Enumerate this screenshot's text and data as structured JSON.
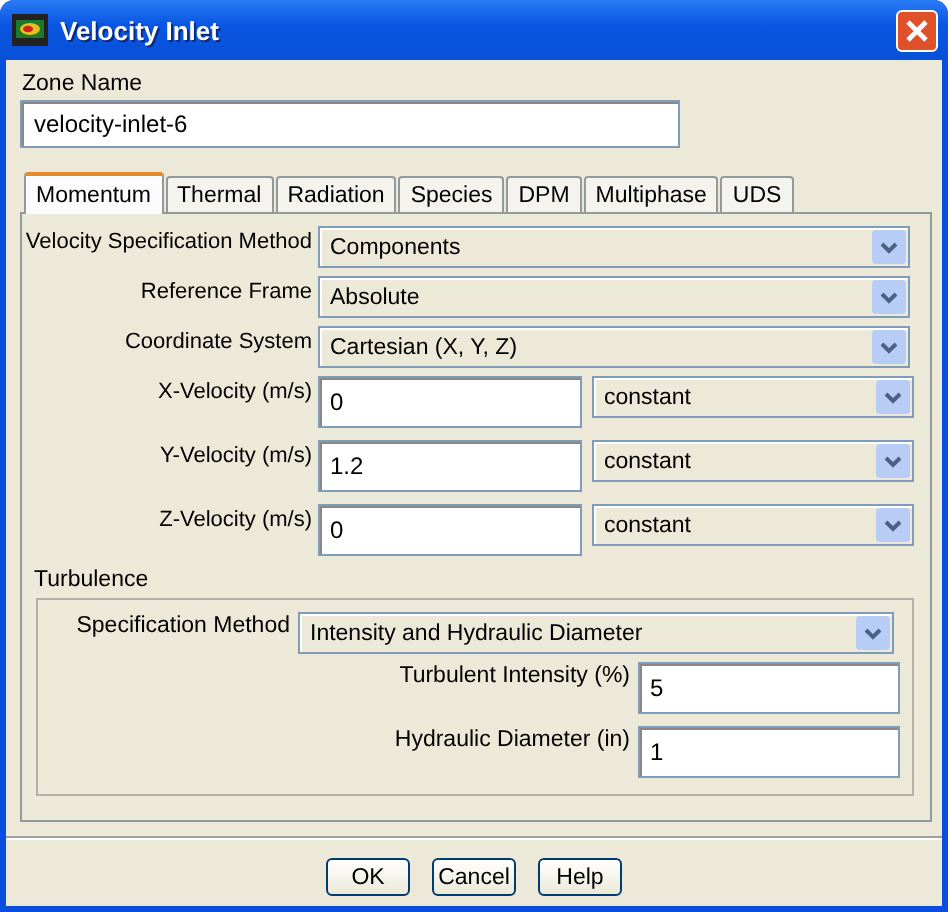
{
  "window": {
    "title": "Velocity Inlet"
  },
  "zone_name": {
    "label": "Zone Name",
    "value": "velocity-inlet-6"
  },
  "tabs": [
    {
      "label": "Momentum",
      "selected": true
    },
    {
      "label": "Thermal",
      "selected": false
    },
    {
      "label": "Radiation",
      "selected": false
    },
    {
      "label": "Species",
      "selected": false
    },
    {
      "label": "DPM",
      "selected": false
    },
    {
      "label": "Multiphase",
      "selected": false
    },
    {
      "label": "UDS",
      "selected": false
    }
  ],
  "momentum": [
    {
      "kind": "select",
      "label": "Velocity Specification Method",
      "value": "Components"
    },
    {
      "kind": "select",
      "label": "Reference Frame",
      "value": "Absolute"
    },
    {
      "kind": "select",
      "label": "Coordinate System",
      "value": "Cartesian (X, Y, Z)"
    },
    {
      "kind": "input_select",
      "label": "X-Velocity (m/s)",
      "value": "0",
      "option": "constant"
    },
    {
      "kind": "input_select",
      "label": "Y-Velocity (m/s)",
      "value": "1.2",
      "option": "constant"
    },
    {
      "kind": "input_select",
      "label": "Z-Velocity (m/s)",
      "value": "0",
      "option": "constant"
    }
  ],
  "turbulence": {
    "title": "Turbulence",
    "rows": [
      {
        "kind": "select",
        "label": "Specification Method",
        "value": "Intensity and Hydraulic Diameter"
      },
      {
        "kind": "input",
        "label": "Turbulent Intensity (%)",
        "value": "5"
      },
      {
        "kind": "input",
        "label": "Hydraulic Diameter (in)",
        "value": "1"
      }
    ]
  },
  "buttons": [
    "OK",
    "Cancel",
    "Help"
  ]
}
